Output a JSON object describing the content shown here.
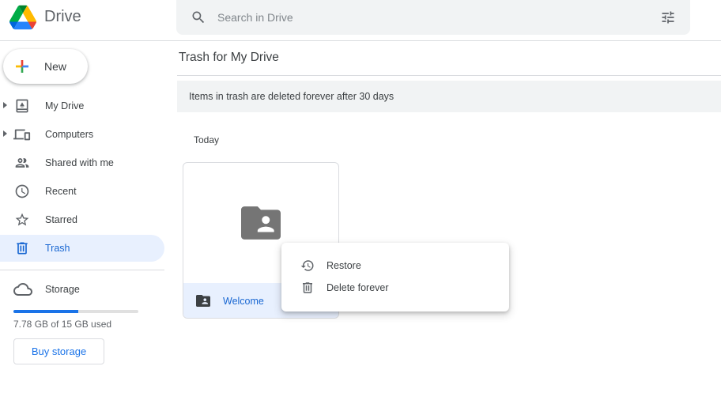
{
  "header": {
    "brand": "Drive",
    "search": {
      "placeholder": "Search in Drive",
      "value": ""
    },
    "search_icon": "search-icon",
    "filter_icon": "tune-icon"
  },
  "sidebar": {
    "new_label": "New",
    "items": [
      {
        "label": "My Drive",
        "icon": "my-drive-icon",
        "expandable": true,
        "active": false
      },
      {
        "label": "Computers",
        "icon": "computers-icon",
        "expandable": true,
        "active": false
      },
      {
        "label": "Shared with me",
        "icon": "people-icon",
        "expandable": false,
        "active": false
      },
      {
        "label": "Recent",
        "icon": "clock-icon",
        "expandable": false,
        "active": false
      },
      {
        "label": "Starred",
        "icon": "star-icon",
        "expandable": false,
        "active": false
      },
      {
        "label": "Trash",
        "icon": "trash-icon",
        "expandable": false,
        "active": true
      }
    ],
    "storage": {
      "label": "Storage",
      "used_text": "7.78 GB of 15 GB used",
      "used_fraction": 0.519,
      "buy_label": "Buy storage"
    }
  },
  "main": {
    "title": "Trash for My Drive",
    "banner": "Items in trash are deleted forever after 30 days",
    "section": "Today",
    "items": [
      {
        "name": "Welcome",
        "type": "shared-folder"
      }
    ]
  },
  "context_menu": {
    "items": [
      {
        "label": "Restore",
        "icon": "restore-icon"
      },
      {
        "label": "Delete forever",
        "icon": "trash-icon"
      }
    ]
  },
  "colors": {
    "accent": "#1a73e8",
    "active_bg": "#e8f0fe",
    "active_text": "#1967d2",
    "surface": "#f1f3f4"
  }
}
